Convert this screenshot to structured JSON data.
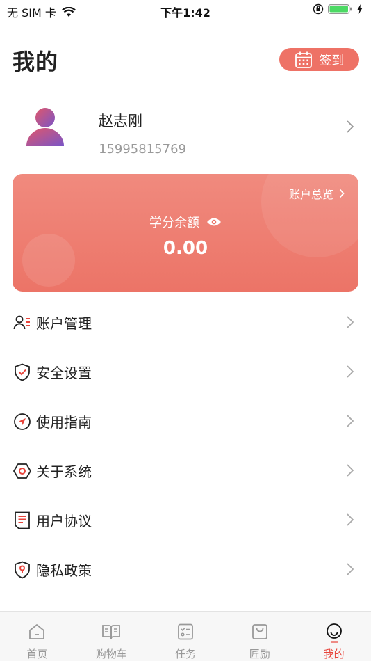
{
  "status_bar": {
    "carrier": "无 SIM 卡",
    "time": "下午1:42",
    "battery_color": "#4cd964"
  },
  "header": {
    "title": "我的",
    "sign_in_label": "签到"
  },
  "profile": {
    "name": "赵志刚",
    "phone": "15995815769"
  },
  "balance_card": {
    "overview_label": "账户总览",
    "label": "学分余额",
    "value": "0.00",
    "color": "#ec7467"
  },
  "menu": [
    {
      "label": "账户管理",
      "icon": "account-manage-icon"
    },
    {
      "label": "安全设置",
      "icon": "shield-check-icon"
    },
    {
      "label": "使用指南",
      "icon": "compass-icon"
    },
    {
      "label": "关于系统",
      "icon": "hexagon-icon"
    },
    {
      "label": "用户协议",
      "icon": "document-icon"
    },
    {
      "label": "隐私政策",
      "icon": "shield-pin-icon"
    }
  ],
  "tabbar": [
    {
      "label": "首页",
      "icon": "home-icon"
    },
    {
      "label": "购物车",
      "icon": "book-icon"
    },
    {
      "label": "任务",
      "icon": "checklist-icon"
    },
    {
      "label": "匠励",
      "icon": "bag-icon"
    },
    {
      "label": "我的",
      "icon": "smile-icon",
      "active": true
    }
  ],
  "accent_color": "#e8453c"
}
